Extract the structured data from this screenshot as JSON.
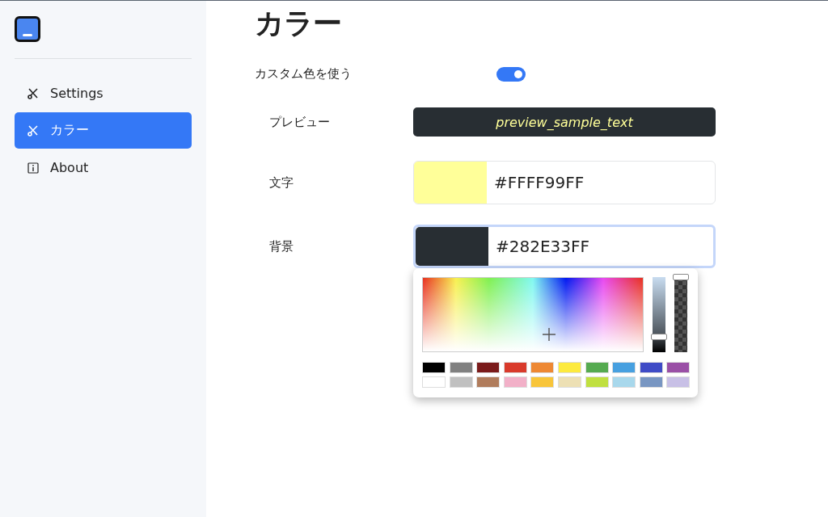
{
  "sidebar": {
    "items": [
      {
        "label": "Settings",
        "kind": "tools",
        "selected": false
      },
      {
        "label": "カラー",
        "kind": "tools",
        "selected": true
      },
      {
        "label": "About",
        "kind": "info",
        "selected": false
      }
    ]
  },
  "title": "カラー",
  "custom_color": {
    "label": "カスタム色を使う",
    "on": true
  },
  "preview": {
    "label": "プレビュー",
    "text": "preview_sample_text"
  },
  "color_fields": [
    {
      "label": "文字",
      "value": "#FFFF99FF",
      "color": "#ffff99",
      "focused": false
    },
    {
      "label": "背景",
      "value": "#282E33FF",
      "color": "#282e33",
      "focused": true
    }
  ],
  "picker": {
    "brightness": {
      "level": 0.2
    },
    "alpha": {
      "level": 1
    },
    "swatches": [
      {
        "color": "#000000"
      },
      {
        "color": "#808080"
      },
      {
        "color": "#7a1a1a"
      },
      {
        "color": "#d93a2b"
      },
      {
        "color": "#ee8833"
      },
      {
        "color": "#fdea3e"
      },
      {
        "color": "#55aa50"
      },
      {
        "color": "#47a0e0"
      },
      {
        "color": "#3f4bc6"
      },
      {
        "color": "#9a4fa6"
      },
      {
        "color": "#ffffff"
      },
      {
        "color": "#c0c0c0"
      },
      {
        "color": "#b07c5c"
      },
      {
        "color": "#f2b0c8"
      },
      {
        "color": "#f8c53a"
      },
      {
        "color": "#ede0b4"
      },
      {
        "color": "#c0e040"
      },
      {
        "color": "#a8d8ec"
      },
      {
        "color": "#7896c2"
      },
      {
        "color": "#c8c0e6"
      }
    ]
  }
}
